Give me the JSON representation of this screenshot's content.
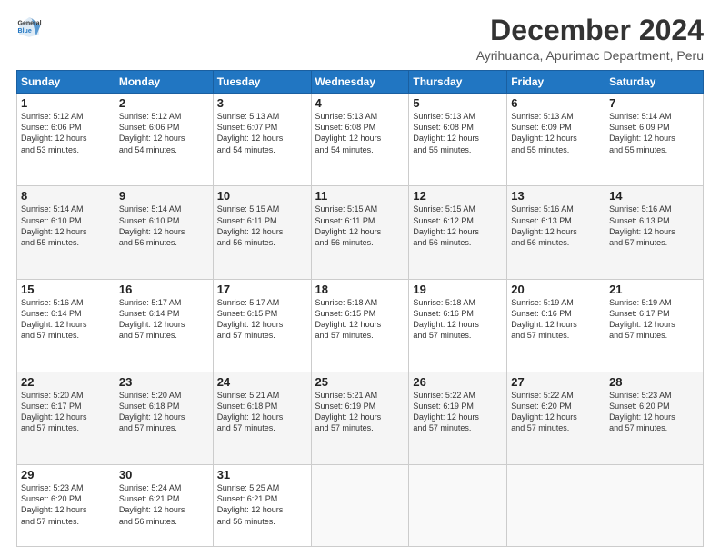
{
  "header": {
    "logo_line1": "General",
    "logo_line2": "Blue",
    "main_title": "December 2024",
    "subtitle": "Ayrihuanca, Apurimac Department, Peru"
  },
  "days_of_week": [
    "Sunday",
    "Monday",
    "Tuesday",
    "Wednesday",
    "Thursday",
    "Friday",
    "Saturday"
  ],
  "weeks": [
    [
      {
        "day": "1",
        "info": "Sunrise: 5:12 AM\nSunset: 6:06 PM\nDaylight: 12 hours\nand 53 minutes."
      },
      {
        "day": "2",
        "info": "Sunrise: 5:12 AM\nSunset: 6:06 PM\nDaylight: 12 hours\nand 54 minutes."
      },
      {
        "day": "3",
        "info": "Sunrise: 5:13 AM\nSunset: 6:07 PM\nDaylight: 12 hours\nand 54 minutes."
      },
      {
        "day": "4",
        "info": "Sunrise: 5:13 AM\nSunset: 6:08 PM\nDaylight: 12 hours\nand 54 minutes."
      },
      {
        "day": "5",
        "info": "Sunrise: 5:13 AM\nSunset: 6:08 PM\nDaylight: 12 hours\nand 55 minutes."
      },
      {
        "day": "6",
        "info": "Sunrise: 5:13 AM\nSunset: 6:09 PM\nDaylight: 12 hours\nand 55 minutes."
      },
      {
        "day": "7",
        "info": "Sunrise: 5:14 AM\nSunset: 6:09 PM\nDaylight: 12 hours\nand 55 minutes."
      }
    ],
    [
      {
        "day": "8",
        "info": "Sunrise: 5:14 AM\nSunset: 6:10 PM\nDaylight: 12 hours\nand 55 minutes."
      },
      {
        "day": "9",
        "info": "Sunrise: 5:14 AM\nSunset: 6:10 PM\nDaylight: 12 hours\nand 56 minutes."
      },
      {
        "day": "10",
        "info": "Sunrise: 5:15 AM\nSunset: 6:11 PM\nDaylight: 12 hours\nand 56 minutes."
      },
      {
        "day": "11",
        "info": "Sunrise: 5:15 AM\nSunset: 6:11 PM\nDaylight: 12 hours\nand 56 minutes."
      },
      {
        "day": "12",
        "info": "Sunrise: 5:15 AM\nSunset: 6:12 PM\nDaylight: 12 hours\nand 56 minutes."
      },
      {
        "day": "13",
        "info": "Sunrise: 5:16 AM\nSunset: 6:13 PM\nDaylight: 12 hours\nand 56 minutes."
      },
      {
        "day": "14",
        "info": "Sunrise: 5:16 AM\nSunset: 6:13 PM\nDaylight: 12 hours\nand 57 minutes."
      }
    ],
    [
      {
        "day": "15",
        "info": "Sunrise: 5:16 AM\nSunset: 6:14 PM\nDaylight: 12 hours\nand 57 minutes."
      },
      {
        "day": "16",
        "info": "Sunrise: 5:17 AM\nSunset: 6:14 PM\nDaylight: 12 hours\nand 57 minutes."
      },
      {
        "day": "17",
        "info": "Sunrise: 5:17 AM\nSunset: 6:15 PM\nDaylight: 12 hours\nand 57 minutes."
      },
      {
        "day": "18",
        "info": "Sunrise: 5:18 AM\nSunset: 6:15 PM\nDaylight: 12 hours\nand 57 minutes."
      },
      {
        "day": "19",
        "info": "Sunrise: 5:18 AM\nSunset: 6:16 PM\nDaylight: 12 hours\nand 57 minutes."
      },
      {
        "day": "20",
        "info": "Sunrise: 5:19 AM\nSunset: 6:16 PM\nDaylight: 12 hours\nand 57 minutes."
      },
      {
        "day": "21",
        "info": "Sunrise: 5:19 AM\nSunset: 6:17 PM\nDaylight: 12 hours\nand 57 minutes."
      }
    ],
    [
      {
        "day": "22",
        "info": "Sunrise: 5:20 AM\nSunset: 6:17 PM\nDaylight: 12 hours\nand 57 minutes."
      },
      {
        "day": "23",
        "info": "Sunrise: 5:20 AM\nSunset: 6:18 PM\nDaylight: 12 hours\nand 57 minutes."
      },
      {
        "day": "24",
        "info": "Sunrise: 5:21 AM\nSunset: 6:18 PM\nDaylight: 12 hours\nand 57 minutes."
      },
      {
        "day": "25",
        "info": "Sunrise: 5:21 AM\nSunset: 6:19 PM\nDaylight: 12 hours\nand 57 minutes."
      },
      {
        "day": "26",
        "info": "Sunrise: 5:22 AM\nSunset: 6:19 PM\nDaylight: 12 hours\nand 57 minutes."
      },
      {
        "day": "27",
        "info": "Sunrise: 5:22 AM\nSunset: 6:20 PM\nDaylight: 12 hours\nand 57 minutes."
      },
      {
        "day": "28",
        "info": "Sunrise: 5:23 AM\nSunset: 6:20 PM\nDaylight: 12 hours\nand 57 minutes."
      }
    ],
    [
      {
        "day": "29",
        "info": "Sunrise: 5:23 AM\nSunset: 6:20 PM\nDaylight: 12 hours\nand 57 minutes."
      },
      {
        "day": "30",
        "info": "Sunrise: 5:24 AM\nSunset: 6:21 PM\nDaylight: 12 hours\nand 56 minutes."
      },
      {
        "day": "31",
        "info": "Sunrise: 5:25 AM\nSunset: 6:21 PM\nDaylight: 12 hours\nand 56 minutes."
      },
      null,
      null,
      null,
      null
    ]
  ]
}
